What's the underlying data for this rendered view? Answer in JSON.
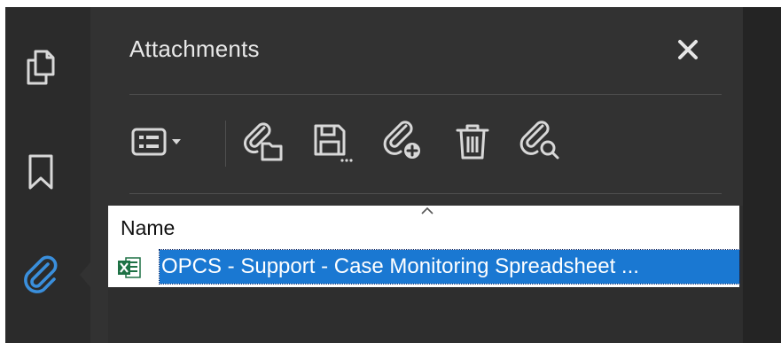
{
  "panel": {
    "title": "Attachments",
    "close_icon": "close-icon",
    "list_header": {
      "name_column": "Name"
    },
    "attachments": [
      {
        "name": "OPCS - Support - Case Monitoring Spreadsheet ...",
        "icon": "excel-file-icon",
        "selected": true
      }
    ]
  },
  "rail": {
    "items": [
      {
        "icon": "pages-icon"
      },
      {
        "icon": "bookmark-icon"
      },
      {
        "icon": "attachment-icon",
        "active": true
      }
    ]
  },
  "toolbar": {
    "items": [
      {
        "icon": "options-menu-icon"
      },
      {
        "icon": "open-attachment-icon"
      },
      {
        "icon": "save-attachment-icon"
      },
      {
        "icon": "add-attachment-icon"
      },
      {
        "icon": "delete-icon"
      },
      {
        "icon": "search-attachment-icon"
      }
    ]
  },
  "colors": {
    "panel_bg": "#323232",
    "rail_bg": "#2b2b2b",
    "accent": "#3a8fdc",
    "selection": "#1a78d2",
    "icon": "#d8d8d8"
  }
}
